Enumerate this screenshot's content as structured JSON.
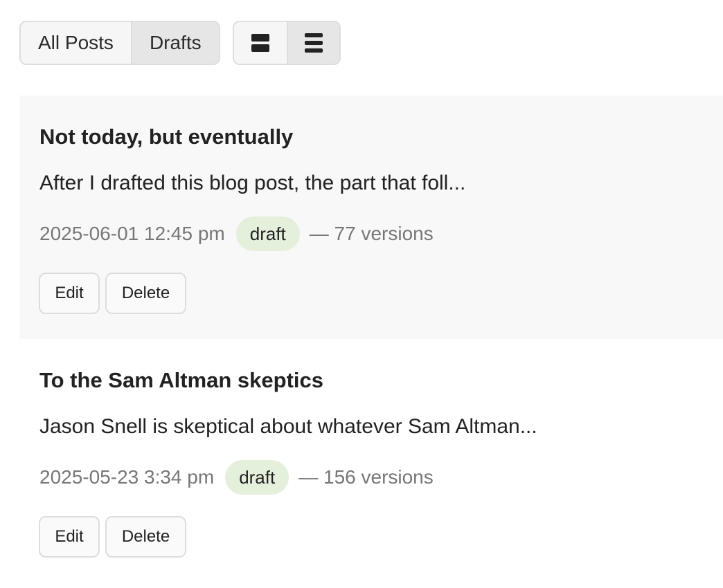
{
  "filter_tabs": {
    "all_posts": "All Posts",
    "drafts": "Drafts",
    "active": "drafts"
  },
  "view_toggle": {
    "expanded_icon": "expanded-view-icon",
    "compact_icon": "compact-list-icon",
    "active": "compact"
  },
  "posts": [
    {
      "title": "Not today, but eventually",
      "excerpt": "After I drafted this blog post, the part that foll...",
      "date": "2025-06-01 12:45 pm",
      "status": "draft",
      "versions": "— 77 versions",
      "edit_label": "Edit",
      "delete_label": "Delete"
    },
    {
      "title": "To the Sam Altman skeptics",
      "excerpt": "Jason Snell is skeptical about whatever Sam Altman...",
      "date": "2025-05-23 3:34 pm",
      "status": "draft",
      "versions": "— 156 versions",
      "edit_label": "Edit",
      "delete_label": "Delete"
    }
  ],
  "colors": {
    "badge_bg": "#e5f0dc",
    "shaded_row": "#f8f8f8",
    "meta_text": "#777777"
  }
}
